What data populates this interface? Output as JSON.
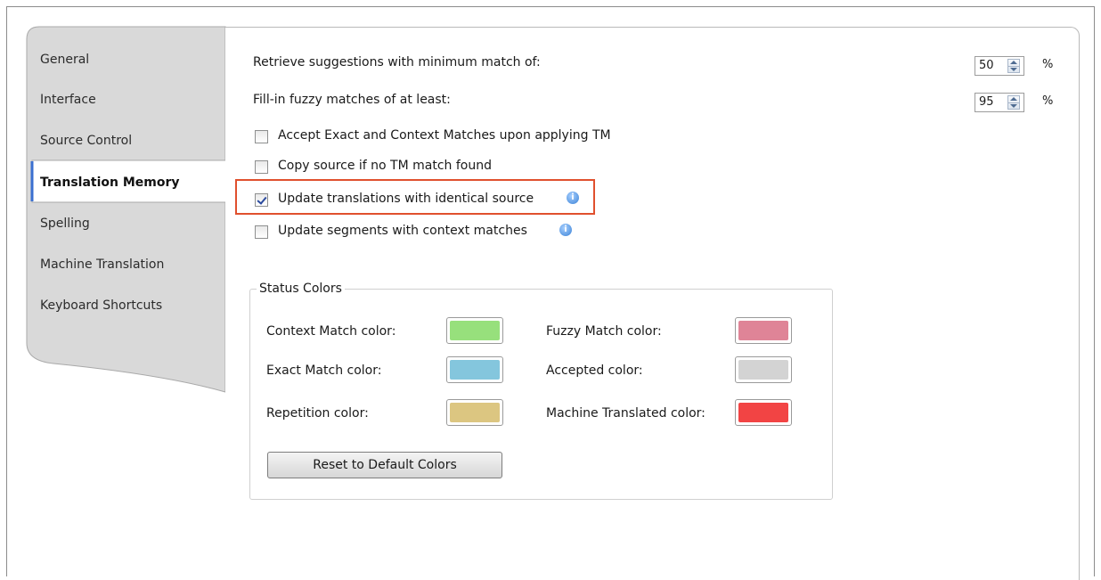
{
  "sidebar": {
    "tabs": [
      {
        "label": "General"
      },
      {
        "label": "Interface"
      },
      {
        "label": "Source Control"
      },
      {
        "label": "Translation Memory"
      },
      {
        "label": "Spelling"
      },
      {
        "label": "Machine Translation"
      },
      {
        "label": "Keyboard Shortcuts"
      }
    ],
    "active_tab": "Translation Memory"
  },
  "settings": {
    "min_match_label": "Retrieve suggestions with minimum match of:",
    "min_match_value": "50",
    "fuzzy_fill_label": "Fill-in fuzzy matches of at least:",
    "fuzzy_fill_value": "95",
    "percent_symbol": "%",
    "checkboxes": [
      {
        "label": "Accept Exact and Context Matches upon applying TM",
        "checked": false
      },
      {
        "label": "Copy source if no TM match found",
        "checked": false
      },
      {
        "label": "Update translations with identical source",
        "checked": true
      },
      {
        "label": "Update segments with context matches",
        "checked": false
      }
    ]
  },
  "status_colors": {
    "title": "Status Colors",
    "items": [
      {
        "label": "Context Match color:",
        "color": "#97e07c"
      },
      {
        "label": "Exact Match color:",
        "color": "#84c6dd"
      },
      {
        "label": "Repetition color:",
        "color": "#dcc681"
      },
      {
        "label": "Fuzzy Match color:",
        "color": "#df8497"
      },
      {
        "label": "Accepted color:",
        "color": "#d3d3d3"
      },
      {
        "label": "Machine Translated color:",
        "color": "#f24444"
      }
    ],
    "reset_button": "Reset to Default Colors"
  },
  "colors": {
    "highlight_border": "#e0502e",
    "info_icon": "#3b82d6"
  }
}
